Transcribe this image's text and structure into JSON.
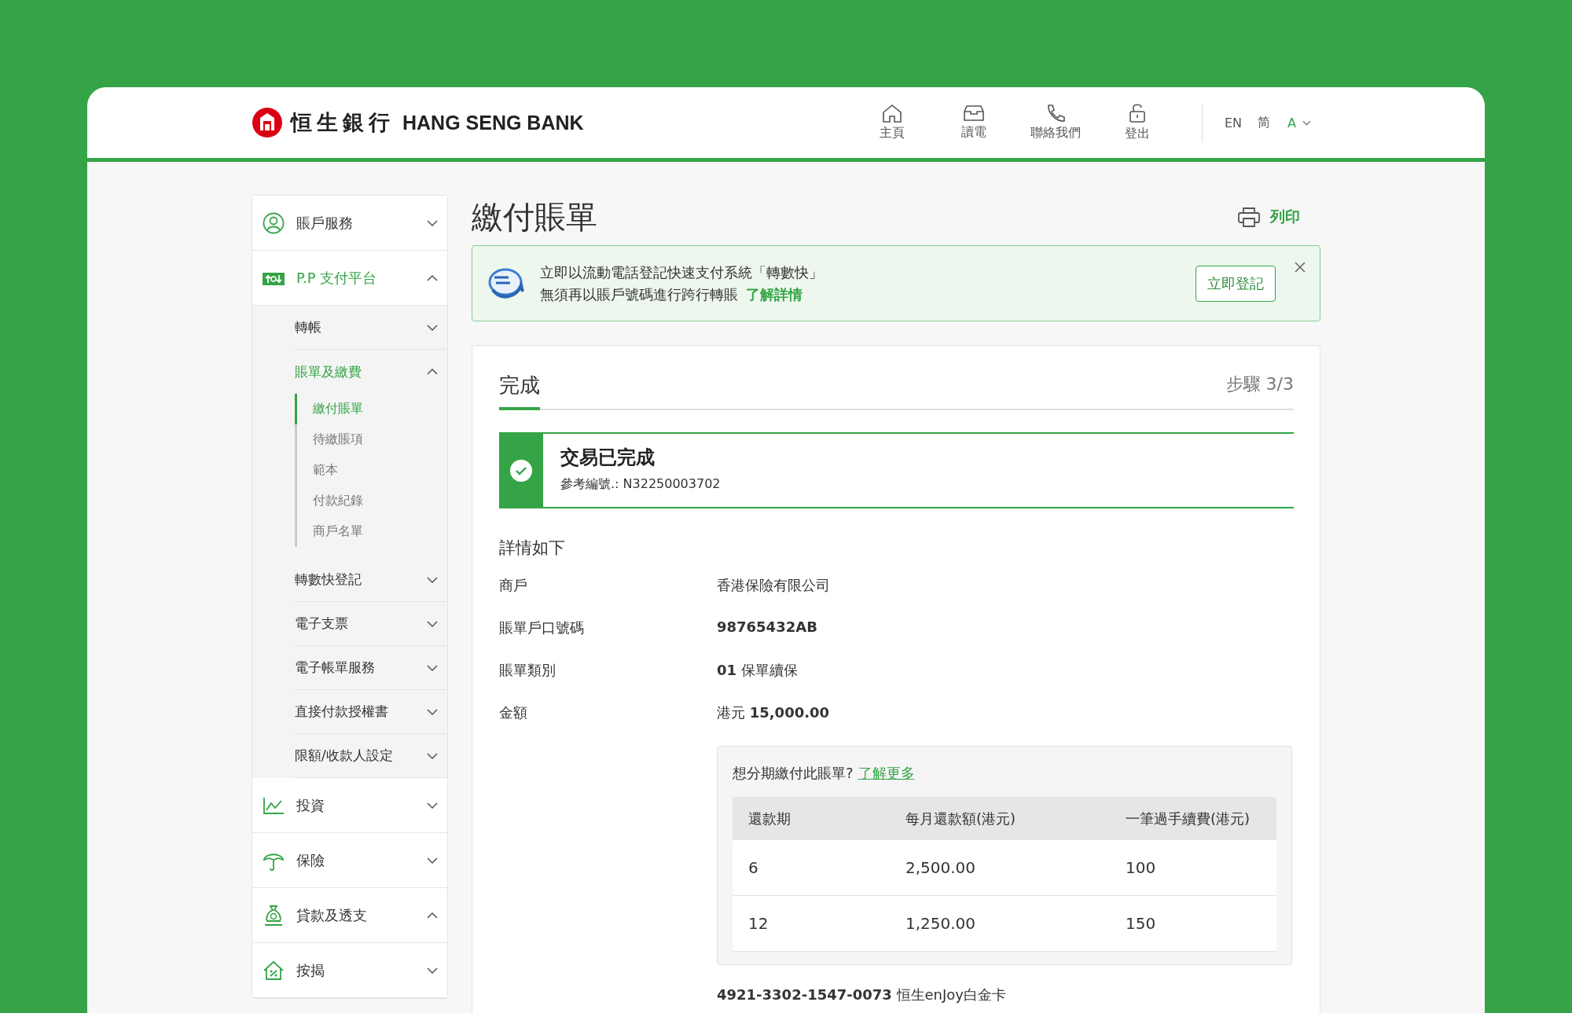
{
  "header": {
    "logo_cn": "恒生銀行",
    "logo_en": "HANG SENG BANK",
    "nav": [
      {
        "label": "主頁"
      },
      {
        "label": "讀電"
      },
      {
        "label": "聯絡我們"
      },
      {
        "label": "登出"
      }
    ],
    "languages": [
      "EN",
      "简"
    ],
    "font_size": "A"
  },
  "sidebar": {
    "items": [
      {
        "label": "賬戶服務",
        "expanded": false,
        "selected": false
      },
      {
        "label": "P.P 支付平台",
        "expanded": true,
        "selected": true,
        "children": [
          {
            "label": "轉帳",
            "expanded": false,
            "selected": false
          },
          {
            "label": "賬單及繳費",
            "expanded": true,
            "selected": true,
            "children": [
              {
                "label": "繳付賬單",
                "selected": true
              },
              {
                "label": "待繳賬項",
                "selected": false
              },
              {
                "label": "範本",
                "selected": false
              },
              {
                "label": "付款紀錄",
                "selected": false
              },
              {
                "label": "商戶名單",
                "selected": false
              }
            ]
          },
          {
            "label": "轉數快登記",
            "expanded": false,
            "selected": false
          },
          {
            "label": "電子支票",
            "expanded": false,
            "selected": false
          },
          {
            "label": "電子帳單服務",
            "expanded": false,
            "selected": false
          },
          {
            "label": "直接付款授權書",
            "expanded": false,
            "selected": false
          },
          {
            "label": "限額/收款人設定",
            "expanded": false,
            "selected": false
          }
        ]
      },
      {
        "label": "投資",
        "expanded": false,
        "selected": false
      },
      {
        "label": "保險",
        "expanded": false,
        "selected": false
      },
      {
        "label": "貸款及透支",
        "expanded": true,
        "selected": false
      },
      {
        "label": "按揭",
        "expanded": false,
        "selected": false
      }
    ]
  },
  "page": {
    "title": "繳付賬單",
    "print": "列印"
  },
  "banner": {
    "line1": "立即以流動電話登記快速支付系統「轉數快」",
    "line2": "無須再以賬戶號碼進行跨行轉賬",
    "link": "了解詳情",
    "button": "立即登記"
  },
  "steps": {
    "current": "完成",
    "counter": "步驟 3/3"
  },
  "result": {
    "title": "交易已完成",
    "reference": "參考編號.: N32250003702"
  },
  "details": {
    "heading": "詳情如下",
    "rows": [
      {
        "label": "商戶",
        "value": "香港保險有限公司"
      },
      {
        "label": "賬單戶口號碼",
        "value": "**98765432AB**"
      },
      {
        "label": "賬單類別",
        "value": "**01** 保單續保"
      },
      {
        "label": "金額",
        "value": "港元 **15,000.00**"
      }
    ]
  },
  "installment": {
    "question": "想分期繳付此賬單?",
    "link": "了解更多",
    "columns": [
      "還款期",
      "每月還款額(港元)",
      "一筆過手續費(港元)"
    ],
    "rows": [
      [
        "6",
        "2,500.00",
        "100"
      ],
      [
        "12",
        "1,250.00",
        "150"
      ]
    ]
  },
  "payment_account": "**4921-3302-1547-0073** 恒生enJoy白金卡"
}
